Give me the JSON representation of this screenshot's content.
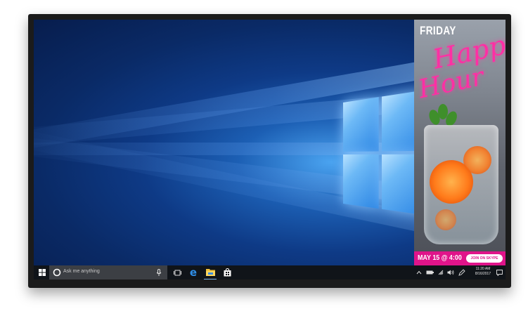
{
  "search": {
    "placeholder": "Ask me anything"
  },
  "promo": {
    "day": "FRIDAY",
    "script_line1": "Happy",
    "script_line2": "Hour",
    "date": "MAY 15 @ 4:00",
    "button": "JOIN ON SKYPE"
  },
  "tray": {
    "time": "11:20 AM",
    "date": "8/16/2017"
  },
  "icons": {
    "start": "windows-icon",
    "cortana": "cortana-icon",
    "mic": "microphone-icon",
    "taskview": "task-view-icon",
    "edge": "edge-icon",
    "explorer": "file-explorer-icon",
    "store": "store-icon",
    "tray": [
      "chevron-up-icon",
      "battery-icon",
      "network-icon",
      "volume-icon",
      "pen-icon",
      "notification-icon"
    ]
  },
  "colors": {
    "accent": "#e0148a",
    "neon": "#ff2fa4",
    "taskbar": "#101419",
    "desktop": "#0e3a86"
  }
}
